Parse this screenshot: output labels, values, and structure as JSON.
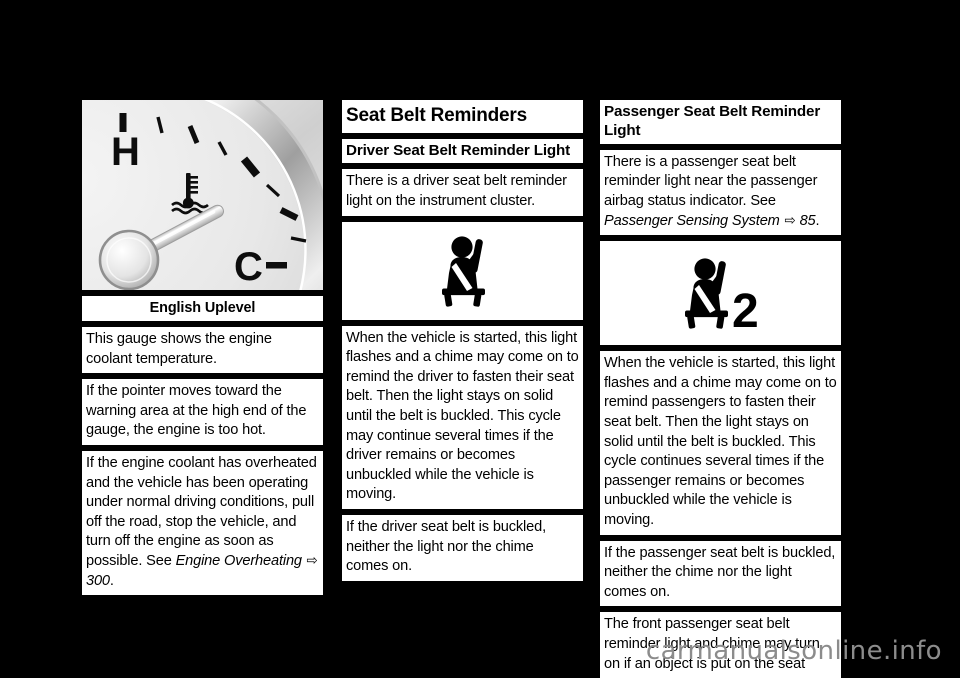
{
  "document": {
    "watermark": "carmanualsonline.info"
  },
  "left_column": {
    "figure": {
      "name": "engine-coolant-temperature-gauge",
      "labels": {
        "hot": "H",
        "cold": "C"
      },
      "caption": "English Uplevel"
    },
    "blocks": [
      {
        "type": "paragraph",
        "text": "This gauge shows the engine coolant temperature."
      },
      {
        "type": "paragraph",
        "text": "If the pointer moves toward the warning area at the high end of the gauge, the engine is too hot."
      },
      {
        "type": "paragraph_with_reference",
        "text_before": "If the engine coolant has overheated and the vehicle has been operating under normal driving conditions, pull off the road, stop the vehicle, and turn off the engine as soon as possible. See ",
        "reference_title": "Engine Overheating",
        "reference_arrow": "⇨",
        "reference_page": "300",
        "text_after": "."
      }
    ]
  },
  "middle_column": {
    "heading_major": "Seat Belt Reminders",
    "heading_minor": "Driver Seat Belt Reminder Light",
    "blocks": [
      {
        "type": "paragraph",
        "text": "There is a driver seat belt reminder light on the instrument cluster."
      },
      {
        "type": "figure",
        "icon": "driver-seat-belt-reminder-telltale"
      },
      {
        "type": "paragraph",
        "text": "When the vehicle is started, this light flashes and a chime may come on to remind the driver to fasten their seat belt. Then the light stays on solid until the belt is buckled. This cycle may continue several times if the driver remains or becomes unbuckled while the vehicle is moving."
      },
      {
        "type": "paragraph",
        "text": "If the driver seat belt is buckled, neither the light nor the chime comes on."
      }
    ]
  },
  "right_column": {
    "heading_minor": "Passenger Seat Belt Reminder Light",
    "blocks": [
      {
        "type": "paragraph_with_reference",
        "text_before": "There is a passenger seat belt reminder light near the passenger airbag status indicator. See ",
        "reference_title": "Passenger Sensing System",
        "reference_arrow": "⇨",
        "reference_page": "85",
        "text_after": "."
      },
      {
        "type": "figure",
        "icon": "passenger-seat-belt-reminder-telltale",
        "badge": "2"
      },
      {
        "type": "paragraph",
        "text": "When the vehicle is started, this light flashes and a chime may come on to remind passengers to fasten their seat belt. Then the light stays on solid until the belt is buckled. This cycle continues several times if the passenger remains or becomes unbuckled while the vehicle is moving."
      },
      {
        "type": "paragraph",
        "text": "If the passenger seat belt is buckled, neither the chime nor the light comes on."
      },
      {
        "type": "paragraph",
        "text": "The front passenger seat belt reminder light and chime may turn on if an object is put on the seat"
      }
    ]
  }
}
